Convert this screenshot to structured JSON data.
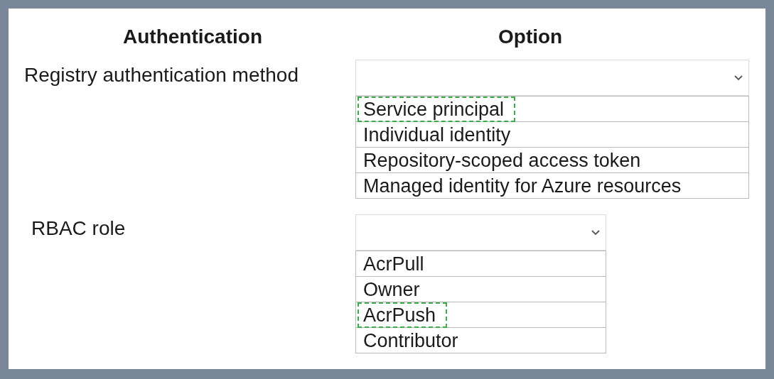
{
  "headers": [
    "Authentication",
    "Option"
  ],
  "questions": [
    {
      "label": "Registry authentication method",
      "options": [
        {
          "label": "Service principal",
          "selected": true
        },
        {
          "label": "Individual identity",
          "selected": false
        },
        {
          "label": "Repository-scoped access token",
          "selected": false
        },
        {
          "label": "Managed identity for Azure resources",
          "selected": false
        }
      ]
    },
    {
      "label": "RBAC role",
      "options": [
        {
          "label": "AcrPull",
          "selected": false
        },
        {
          "label": "Owner",
          "selected": false
        },
        {
          "label": "AcrPush",
          "selected": true
        },
        {
          "label": "Contributor",
          "selected": false
        }
      ]
    }
  ]
}
